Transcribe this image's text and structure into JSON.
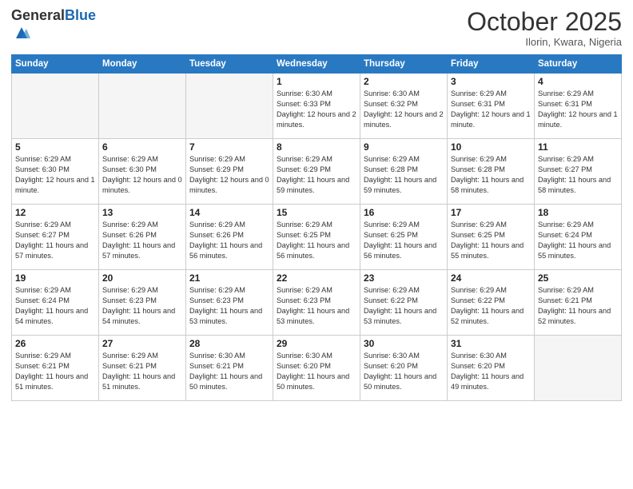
{
  "header": {
    "logo_general": "General",
    "logo_blue": "Blue",
    "month": "October 2025",
    "location": "Ilorin, Kwara, Nigeria"
  },
  "weekdays": [
    "Sunday",
    "Monday",
    "Tuesday",
    "Wednesday",
    "Thursday",
    "Friday",
    "Saturday"
  ],
  "weeks": [
    [
      {
        "day": "",
        "info": ""
      },
      {
        "day": "",
        "info": ""
      },
      {
        "day": "",
        "info": ""
      },
      {
        "day": "1",
        "info": "Sunrise: 6:30 AM\nSunset: 6:33 PM\nDaylight: 12 hours and 2 minutes."
      },
      {
        "day": "2",
        "info": "Sunrise: 6:30 AM\nSunset: 6:32 PM\nDaylight: 12 hours and 2 minutes."
      },
      {
        "day": "3",
        "info": "Sunrise: 6:29 AM\nSunset: 6:31 PM\nDaylight: 12 hours and 1 minute."
      },
      {
        "day": "4",
        "info": "Sunrise: 6:29 AM\nSunset: 6:31 PM\nDaylight: 12 hours and 1 minute."
      }
    ],
    [
      {
        "day": "5",
        "info": "Sunrise: 6:29 AM\nSunset: 6:30 PM\nDaylight: 12 hours and 1 minute."
      },
      {
        "day": "6",
        "info": "Sunrise: 6:29 AM\nSunset: 6:30 PM\nDaylight: 12 hours and 0 minutes."
      },
      {
        "day": "7",
        "info": "Sunrise: 6:29 AM\nSunset: 6:29 PM\nDaylight: 12 hours and 0 minutes."
      },
      {
        "day": "8",
        "info": "Sunrise: 6:29 AM\nSunset: 6:29 PM\nDaylight: 11 hours and 59 minutes."
      },
      {
        "day": "9",
        "info": "Sunrise: 6:29 AM\nSunset: 6:28 PM\nDaylight: 11 hours and 59 minutes."
      },
      {
        "day": "10",
        "info": "Sunrise: 6:29 AM\nSunset: 6:28 PM\nDaylight: 11 hours and 58 minutes."
      },
      {
        "day": "11",
        "info": "Sunrise: 6:29 AM\nSunset: 6:27 PM\nDaylight: 11 hours and 58 minutes."
      }
    ],
    [
      {
        "day": "12",
        "info": "Sunrise: 6:29 AM\nSunset: 6:27 PM\nDaylight: 11 hours and 57 minutes."
      },
      {
        "day": "13",
        "info": "Sunrise: 6:29 AM\nSunset: 6:26 PM\nDaylight: 11 hours and 57 minutes."
      },
      {
        "day": "14",
        "info": "Sunrise: 6:29 AM\nSunset: 6:26 PM\nDaylight: 11 hours and 56 minutes."
      },
      {
        "day": "15",
        "info": "Sunrise: 6:29 AM\nSunset: 6:25 PM\nDaylight: 11 hours and 56 minutes."
      },
      {
        "day": "16",
        "info": "Sunrise: 6:29 AM\nSunset: 6:25 PM\nDaylight: 11 hours and 56 minutes."
      },
      {
        "day": "17",
        "info": "Sunrise: 6:29 AM\nSunset: 6:25 PM\nDaylight: 11 hours and 55 minutes."
      },
      {
        "day": "18",
        "info": "Sunrise: 6:29 AM\nSunset: 6:24 PM\nDaylight: 11 hours and 55 minutes."
      }
    ],
    [
      {
        "day": "19",
        "info": "Sunrise: 6:29 AM\nSunset: 6:24 PM\nDaylight: 11 hours and 54 minutes."
      },
      {
        "day": "20",
        "info": "Sunrise: 6:29 AM\nSunset: 6:23 PM\nDaylight: 11 hours and 54 minutes."
      },
      {
        "day": "21",
        "info": "Sunrise: 6:29 AM\nSunset: 6:23 PM\nDaylight: 11 hours and 53 minutes."
      },
      {
        "day": "22",
        "info": "Sunrise: 6:29 AM\nSunset: 6:23 PM\nDaylight: 11 hours and 53 minutes."
      },
      {
        "day": "23",
        "info": "Sunrise: 6:29 AM\nSunset: 6:22 PM\nDaylight: 11 hours and 53 minutes."
      },
      {
        "day": "24",
        "info": "Sunrise: 6:29 AM\nSunset: 6:22 PM\nDaylight: 11 hours and 52 minutes."
      },
      {
        "day": "25",
        "info": "Sunrise: 6:29 AM\nSunset: 6:21 PM\nDaylight: 11 hours and 52 minutes."
      }
    ],
    [
      {
        "day": "26",
        "info": "Sunrise: 6:29 AM\nSunset: 6:21 PM\nDaylight: 11 hours and 51 minutes."
      },
      {
        "day": "27",
        "info": "Sunrise: 6:29 AM\nSunset: 6:21 PM\nDaylight: 11 hours and 51 minutes."
      },
      {
        "day": "28",
        "info": "Sunrise: 6:30 AM\nSunset: 6:21 PM\nDaylight: 11 hours and 50 minutes."
      },
      {
        "day": "29",
        "info": "Sunrise: 6:30 AM\nSunset: 6:20 PM\nDaylight: 11 hours and 50 minutes."
      },
      {
        "day": "30",
        "info": "Sunrise: 6:30 AM\nSunset: 6:20 PM\nDaylight: 11 hours and 50 minutes."
      },
      {
        "day": "31",
        "info": "Sunrise: 6:30 AM\nSunset: 6:20 PM\nDaylight: 11 hours and 49 minutes."
      },
      {
        "day": "",
        "info": ""
      }
    ]
  ]
}
